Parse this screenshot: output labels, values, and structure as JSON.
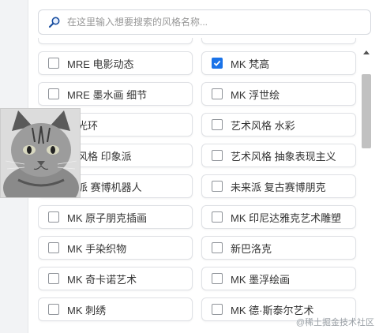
{
  "search": {
    "placeholder": "在这里输入想要搜索的风格名称..."
  },
  "styles": [
    {
      "label": "",
      "checked": false
    },
    {
      "label": "",
      "checked": false
    },
    {
      "label": "MRE 电影动态",
      "checked": false
    },
    {
      "label": "MK 梵高",
      "checked": true
    },
    {
      "label": "MRE 墨水画 细节",
      "checked": false
    },
    {
      "label": "MK 浮世绘",
      "checked": false
    },
    {
      "label": "术光环",
      "checked": false
    },
    {
      "label": "艺术风格 水彩",
      "checked": false
    },
    {
      "label": "术风格 印象派",
      "checked": false
    },
    {
      "label": "艺术风格 抽象表现主义",
      "checked": false
    },
    {
      "label": "来派 赛博机器人",
      "checked": false
    },
    {
      "label": "未来派 复古赛博朋克",
      "checked": false
    },
    {
      "label": "MK 原子朋克插画",
      "checked": false
    },
    {
      "label": "MK 印尼达雅克艺术雕塑",
      "checked": false
    },
    {
      "label": "MK 手染织物",
      "checked": false
    },
    {
      "label": "新巴洛克",
      "checked": false
    },
    {
      "label": "MK 奇卡诺艺术",
      "checked": false
    },
    {
      "label": "MK 墨浮绘画",
      "checked": false
    },
    {
      "label": "MK 刺绣",
      "checked": false
    },
    {
      "label": "MK 德·斯泰尔艺术",
      "checked": false
    }
  ],
  "colors": {
    "checked": "#1a73e8",
    "border": "#dfe1e5"
  },
  "watermark": "@稀土掘金技术社区"
}
